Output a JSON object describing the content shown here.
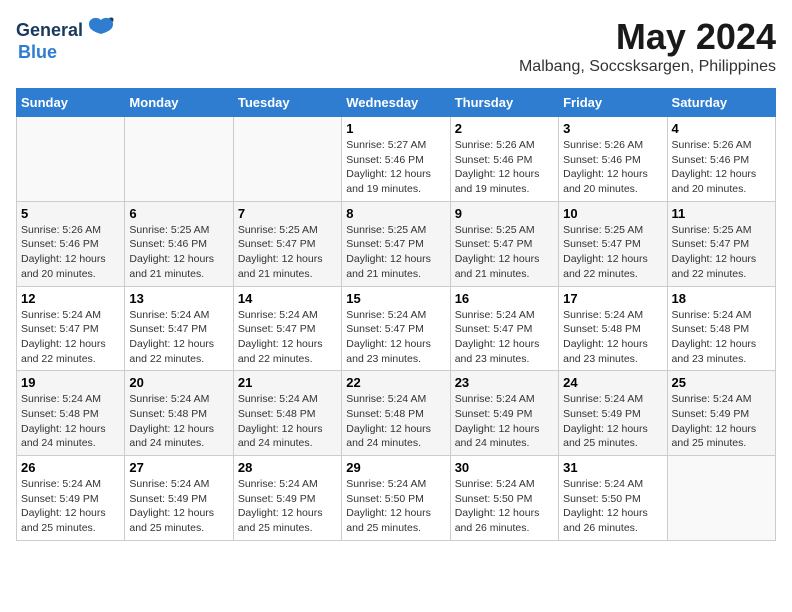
{
  "logo": {
    "general": "General",
    "blue": "Blue",
    "bird_symbol": "▶"
  },
  "title": {
    "month_year": "May 2024",
    "location": "Malbang, Soccsksargen, Philippines"
  },
  "weekdays": [
    "Sunday",
    "Monday",
    "Tuesday",
    "Wednesday",
    "Thursday",
    "Friday",
    "Saturday"
  ],
  "weeks": [
    [
      {
        "day": "",
        "info": ""
      },
      {
        "day": "",
        "info": ""
      },
      {
        "day": "",
        "info": ""
      },
      {
        "day": "1",
        "info": "Sunrise: 5:27 AM\nSunset: 5:46 PM\nDaylight: 12 hours\nand 19 minutes."
      },
      {
        "day": "2",
        "info": "Sunrise: 5:26 AM\nSunset: 5:46 PM\nDaylight: 12 hours\nand 19 minutes."
      },
      {
        "day": "3",
        "info": "Sunrise: 5:26 AM\nSunset: 5:46 PM\nDaylight: 12 hours\nand 20 minutes."
      },
      {
        "day": "4",
        "info": "Sunrise: 5:26 AM\nSunset: 5:46 PM\nDaylight: 12 hours\nand 20 minutes."
      }
    ],
    [
      {
        "day": "5",
        "info": "Sunrise: 5:26 AM\nSunset: 5:46 PM\nDaylight: 12 hours\nand 20 minutes."
      },
      {
        "day": "6",
        "info": "Sunrise: 5:25 AM\nSunset: 5:46 PM\nDaylight: 12 hours\nand 21 minutes."
      },
      {
        "day": "7",
        "info": "Sunrise: 5:25 AM\nSunset: 5:47 PM\nDaylight: 12 hours\nand 21 minutes."
      },
      {
        "day": "8",
        "info": "Sunrise: 5:25 AM\nSunset: 5:47 PM\nDaylight: 12 hours\nand 21 minutes."
      },
      {
        "day": "9",
        "info": "Sunrise: 5:25 AM\nSunset: 5:47 PM\nDaylight: 12 hours\nand 21 minutes."
      },
      {
        "day": "10",
        "info": "Sunrise: 5:25 AM\nSunset: 5:47 PM\nDaylight: 12 hours\nand 22 minutes."
      },
      {
        "day": "11",
        "info": "Sunrise: 5:25 AM\nSunset: 5:47 PM\nDaylight: 12 hours\nand 22 minutes."
      }
    ],
    [
      {
        "day": "12",
        "info": "Sunrise: 5:24 AM\nSunset: 5:47 PM\nDaylight: 12 hours\nand 22 minutes."
      },
      {
        "day": "13",
        "info": "Sunrise: 5:24 AM\nSunset: 5:47 PM\nDaylight: 12 hours\nand 22 minutes."
      },
      {
        "day": "14",
        "info": "Sunrise: 5:24 AM\nSunset: 5:47 PM\nDaylight: 12 hours\nand 22 minutes."
      },
      {
        "day": "15",
        "info": "Sunrise: 5:24 AM\nSunset: 5:47 PM\nDaylight: 12 hours\nand 23 minutes."
      },
      {
        "day": "16",
        "info": "Sunrise: 5:24 AM\nSunset: 5:47 PM\nDaylight: 12 hours\nand 23 minutes."
      },
      {
        "day": "17",
        "info": "Sunrise: 5:24 AM\nSunset: 5:48 PM\nDaylight: 12 hours\nand 23 minutes."
      },
      {
        "day": "18",
        "info": "Sunrise: 5:24 AM\nSunset: 5:48 PM\nDaylight: 12 hours\nand 23 minutes."
      }
    ],
    [
      {
        "day": "19",
        "info": "Sunrise: 5:24 AM\nSunset: 5:48 PM\nDaylight: 12 hours\nand 24 minutes."
      },
      {
        "day": "20",
        "info": "Sunrise: 5:24 AM\nSunset: 5:48 PM\nDaylight: 12 hours\nand 24 minutes."
      },
      {
        "day": "21",
        "info": "Sunrise: 5:24 AM\nSunset: 5:48 PM\nDaylight: 12 hours\nand 24 minutes."
      },
      {
        "day": "22",
        "info": "Sunrise: 5:24 AM\nSunset: 5:48 PM\nDaylight: 12 hours\nand 24 minutes."
      },
      {
        "day": "23",
        "info": "Sunrise: 5:24 AM\nSunset: 5:49 PM\nDaylight: 12 hours\nand 24 minutes."
      },
      {
        "day": "24",
        "info": "Sunrise: 5:24 AM\nSunset: 5:49 PM\nDaylight: 12 hours\nand 25 minutes."
      },
      {
        "day": "25",
        "info": "Sunrise: 5:24 AM\nSunset: 5:49 PM\nDaylight: 12 hours\nand 25 minutes."
      }
    ],
    [
      {
        "day": "26",
        "info": "Sunrise: 5:24 AM\nSunset: 5:49 PM\nDaylight: 12 hours\nand 25 minutes."
      },
      {
        "day": "27",
        "info": "Sunrise: 5:24 AM\nSunset: 5:49 PM\nDaylight: 12 hours\nand 25 minutes."
      },
      {
        "day": "28",
        "info": "Sunrise: 5:24 AM\nSunset: 5:49 PM\nDaylight: 12 hours\nand 25 minutes."
      },
      {
        "day": "29",
        "info": "Sunrise: 5:24 AM\nSunset: 5:50 PM\nDaylight: 12 hours\nand 25 minutes."
      },
      {
        "day": "30",
        "info": "Sunrise: 5:24 AM\nSunset: 5:50 PM\nDaylight: 12 hours\nand 26 minutes."
      },
      {
        "day": "31",
        "info": "Sunrise: 5:24 AM\nSunset: 5:50 PM\nDaylight: 12 hours\nand 26 minutes."
      },
      {
        "day": "",
        "info": ""
      }
    ]
  ]
}
